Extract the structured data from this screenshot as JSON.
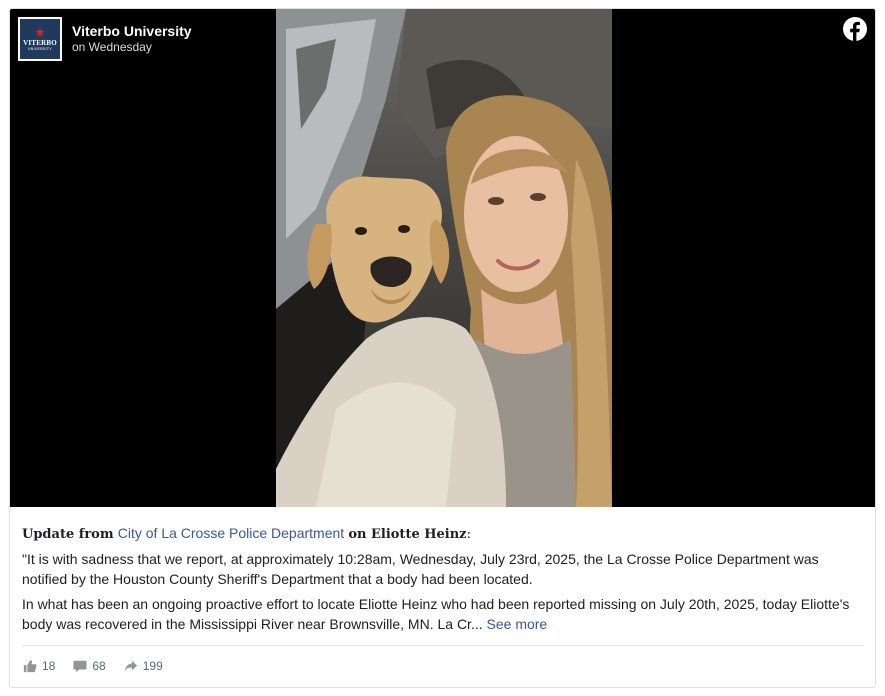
{
  "post": {
    "page_name": "Viterbo University",
    "time": "on Wednesday",
    "avatar": {
      "logo_text": "VITERBO",
      "logo_subtext": "UNIVERSITY"
    },
    "update_prefix": "Update from",
    "source_link": "City of La Crosse Police Department",
    "update_on": "on Eliotte Heinz",
    "update_colon": ":",
    "paragraph1": "\"It is with sadness that we report, at approximately 10:28am, Wednesday, July 23rd, 2025, the La Crosse Police Department was notified by the Houston County Sheriff's Department that a body had been located.",
    "paragraph2": "In what has been an ongoing proactive effort to locate Eliotte Heinz who had been reported missing on July 20th, 2025, today Eliotte's body was recovered in the Mississippi River near Brownsville, MN. La Cr...",
    "see_more": "See more"
  },
  "stats": {
    "likes": "18",
    "comments": "68",
    "shares": "199"
  },
  "colors": {
    "link": "#385898",
    "avatar_bg": "#1f3a5c",
    "facebook_icon": "#ffffff",
    "media_bg": "#000000"
  },
  "icons": [
    "facebook-icon",
    "like-icon",
    "comment-icon",
    "share-icon"
  ]
}
